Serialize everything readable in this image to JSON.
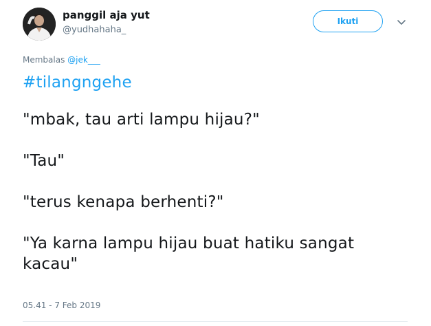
{
  "author": {
    "display_name": "panggil aja yut",
    "handle": "@yudhahaha_"
  },
  "follow_button": {
    "label": "Ikuti"
  },
  "reply": {
    "prefix": "Membalas ",
    "mention": "@jek___"
  },
  "tweet": {
    "hashtag": "#tilangngehe",
    "lines": [
      "\"mbak, tau arti lampu hijau?\"",
      "\"Tau\"",
      "\"terus kenapa berhenti?\"",
      "\"Ya karna lampu hijau buat hatiku sangat kacau\""
    ]
  },
  "timestamp": "05.41 - 7 Feb 2019",
  "colors": {
    "accent": "#1da1f2",
    "secondary_text": "#657786",
    "primary_text": "#14171a"
  },
  "icons": {
    "menu": "chevron-down-icon"
  }
}
